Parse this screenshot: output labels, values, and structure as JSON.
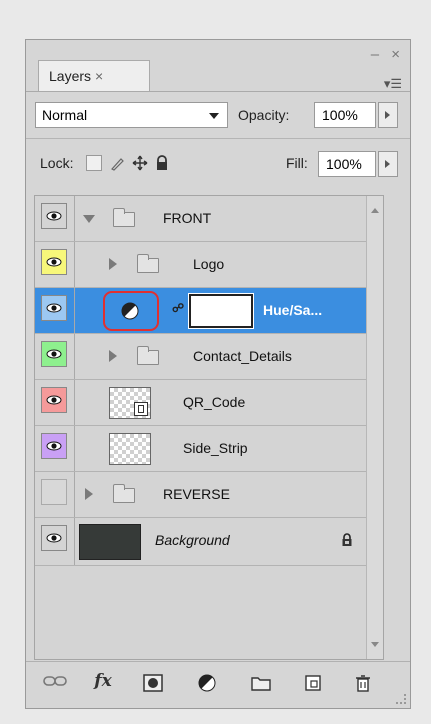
{
  "panel": {
    "tab_label": "Layers",
    "tab_close": "×",
    "window_controls": "– ×",
    "menu_icon": "▾☰",
    "blend_mode": "Normal",
    "opacity_label": "Opacity:",
    "opacity_value": "100%",
    "lock_label": "Lock:",
    "fill_label": "Fill:",
    "fill_value": "100%"
  },
  "layers": [
    {
      "name": "FRONT",
      "type": "group",
      "expanded": true,
      "visible": true,
      "color": "#d4d4d4"
    },
    {
      "name": "Logo",
      "type": "group",
      "expanded": false,
      "visible": true,
      "color": "#f7f77a"
    },
    {
      "name": "Hue/Sa...",
      "type": "adjustment",
      "visible": true,
      "selected": true,
      "color": "#9cc8f2"
    },
    {
      "name": "Contact_Details",
      "type": "group",
      "expanded": false,
      "visible": true,
      "color": "#8ef08e"
    },
    {
      "name": "QR_Code",
      "type": "smart-object",
      "visible": true,
      "color": "#f59a9a"
    },
    {
      "name": "Side_Strip",
      "type": "pixel",
      "visible": true,
      "color": "#c9a0f5"
    },
    {
      "name": "REVERSE",
      "type": "group",
      "expanded": false,
      "visible": false,
      "color": "#d4d4d4"
    },
    {
      "name": "Background",
      "type": "background",
      "visible": true,
      "locked": true,
      "color": "#d4d4d4"
    }
  ],
  "bottom_icons": [
    "link-icon",
    "fx-icon",
    "mask-icon",
    "adjustment-icon",
    "folder-icon",
    "new-layer-icon",
    "trash-icon"
  ],
  "bottom_glyphs": {
    "fx": "fx"
  },
  "highlight_color": "#e03030",
  "selection_color": "#3b8ee0"
}
